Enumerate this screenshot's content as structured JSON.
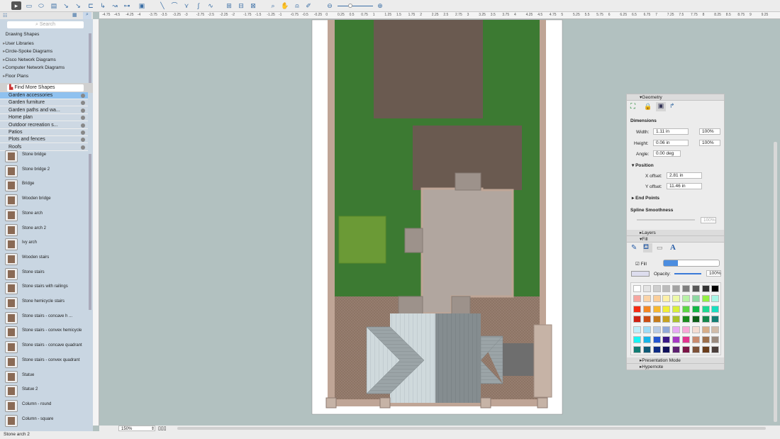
{
  "toolbar": {
    "tools": [
      "pointer",
      "rectangle",
      "ellipse",
      "text-box",
      "connector",
      "smart-connector",
      "elbow-connector",
      "curved-connector",
      "round-connector",
      "tree-connector",
      "insert",
      "line",
      "arc",
      "polyline",
      "spline",
      "freehand",
      "group",
      "align",
      "arrange",
      "zoom",
      "pan",
      "stamp",
      "eyedropper"
    ],
    "zoom_slider_value": 0.35
  },
  "sidebar": {
    "search_placeholder": "Search",
    "libraries": [
      "Drawing Shapes",
      "User Libraries",
      "Circle-Spoke Diagrams",
      "Cisco Network Diagrams",
      "Computer Network Diagrams",
      "Floor Plans"
    ],
    "find_more": "Find More Shapes",
    "categories": [
      "Garden accessories",
      "Garden furniture",
      "Garden paths and wa...",
      "Home plan",
      "Outdoor recreation s...",
      "Patios",
      "Plots and fences",
      "Roofs"
    ],
    "items": [
      "Stone bridge",
      "Stone bridge 2",
      "Bridge",
      "Wooden bridge",
      "Stone arch",
      "Stone arch 2",
      "Ivy arch",
      "Wooden stairs",
      "Stone stairs",
      "Stone stairs with railings",
      "Stone hemicycle stairs",
      "Stone stairs - concave h ...",
      "Stone stairs - convex hemicycle",
      "Stone stairs - concave quadrant",
      "Stone stairs - convex quadrant",
      "Statue",
      "Statue 2",
      "Column - round",
      "Column - square"
    ]
  },
  "ruler": {
    "labels": [
      "-4.75",
      "-4.5",
      "-4.25",
      "-4",
      "-3.75",
      "-3.5",
      "-3.25",
      "-3",
      "-2.75",
      "-2.5",
      "-2.25",
      "-2",
      "-1.75",
      "-1.5",
      "-1.25",
      "-1",
      "-0.75",
      "-0.5",
      "-0.25",
      "0",
      "0.25",
      "0.5",
      "0.75",
      "1",
      "1.25",
      "1.5",
      "1.75",
      "2",
      "2.25",
      "2.5",
      "2.75",
      "3",
      "3.25",
      "3.5",
      "3.75",
      "4",
      "4.25",
      "4.5",
      "4.75",
      "5",
      "5.25",
      "5.5",
      "5.75",
      "6",
      "6.25",
      "6.5",
      "6.75",
      "7",
      "7.25",
      "7.5",
      "7.75",
      "8",
      "8.25",
      "8.5",
      "8.75",
      "9",
      "9.25"
    ]
  },
  "geometry": {
    "title": "Geometry",
    "dimensions": "Dimensions",
    "width_label": "Width:",
    "width": "1.11 in",
    "width_pct": "100%",
    "height_label": "Height:",
    "height": "0.06 in",
    "height_pct": "100%",
    "angle_label": "Angle:",
    "angle": "0.00 deg",
    "position": "Position",
    "x_label": "X offset:",
    "x": "2.81 in",
    "y_label": "Y offset:",
    "y": "11.46 in",
    "end_points": "End Points",
    "spline": "Spline Smoothness",
    "spline_value": "100%"
  },
  "layers": "Layers",
  "fill": {
    "title": "Fill",
    "fill_label": "Fill",
    "fill_checked": true,
    "opacity_label": "Opacity:",
    "opacity": "100%",
    "palette": [
      "#ffffff",
      "#e4e4e4",
      "#cfcfcf",
      "#bcbcbc",
      "#a3a3a3",
      "#7f7f7f",
      "#585858",
      "#333333",
      "#000000",
      "#f7a6a0",
      "#fbd4a8",
      "#fbcf9b",
      "#fdf1a8",
      "#eefaa8",
      "#b9f2a6",
      "#8ed9a2",
      "#93f044",
      "#a8f8e8",
      "#f42a12",
      "#f48722",
      "#f7b730",
      "#f1ee37",
      "#d9ef3a",
      "#5cd645",
      "#13b645",
      "#1ed993",
      "#19dec0",
      "#ce2113",
      "#cb4c14",
      "#c57b1c",
      "#c6a21f",
      "#a9c12a",
      "#1a8b1d",
      "#0d5e18",
      "#13854a",
      "#157e74",
      "#bfeefa",
      "#9edcf7",
      "#b8cbe6",
      "#90a8d9",
      "#e7a9f5",
      "#f8a7d8",
      "#f4dcd2",
      "#d7ae89",
      "#d1bca9",
      "#18f4f4",
      "#16b5e8",
      "#2455d0",
      "#3a1887",
      "#a637c4",
      "#e1328e",
      "#c98a6e",
      "#9d6f4b",
      "#9a8a7e",
      "#127c74",
      "#0e5a77",
      "#0d2b84",
      "#10105a",
      "#5c1f6f",
      "#7b1546",
      "#7d5138",
      "#6a3d1b",
      "#4b3f3b"
    ]
  },
  "presentation": "Presentation Mode",
  "hypernote": "Hypernote",
  "zoom": "150%",
  "status": "Stone arch 2",
  "colors": {
    "lawn": "#3c7a32",
    "house_roof": "#6a5a50",
    "patio": "#b1a69f",
    "paving": "#8c7364",
    "wall": "#bfa596",
    "hedge": "#6b9a36"
  }
}
